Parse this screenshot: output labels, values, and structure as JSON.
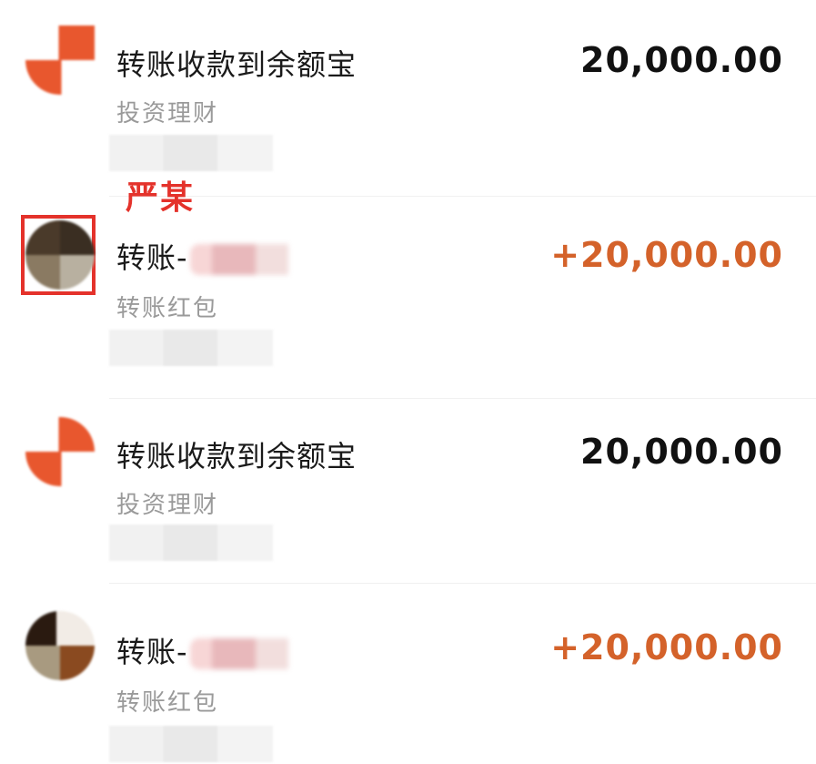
{
  "annotation": {
    "label": "严某"
  },
  "transactions": [
    {
      "title": "转账收款到余额宝",
      "subtitle": "投资理财",
      "amount": "20,000.00",
      "avatar_icon": "yuebao-icon",
      "direction": "neutral"
    },
    {
      "title": "转账-",
      "subtitle": "转账红包",
      "amount": "+20,000.00",
      "avatar_icon": "contact-avatar-icon",
      "direction": "income"
    },
    {
      "title": "转账收款到余额宝",
      "subtitle": "投资理财",
      "amount": "20,000.00",
      "avatar_icon": "yuebao-icon",
      "direction": "neutral"
    },
    {
      "title": "转账-",
      "subtitle": "转账红包",
      "amount": "+20,000.00",
      "avatar_icon": "contact-avatar-icon",
      "direction": "income"
    }
  ],
  "colors": {
    "income": "#d4622a",
    "annotation": "#e4322b",
    "yuebao_orange": "#e8572e"
  }
}
